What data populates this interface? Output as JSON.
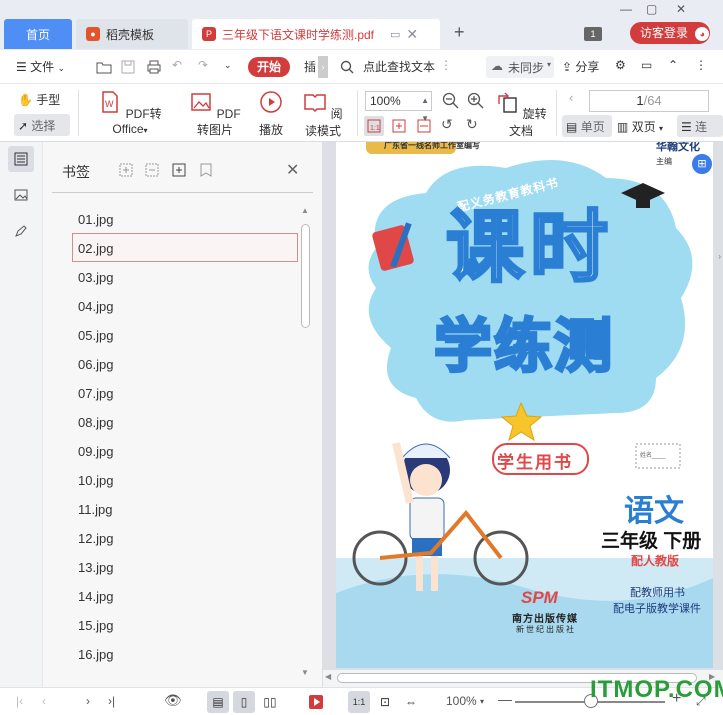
{
  "tabs": {
    "home": "首页",
    "templates": "稻壳模板",
    "document": "三年级下语文课时学练测.pdf"
  },
  "titlebar": {
    "badge": "1",
    "login": "访客登录"
  },
  "menubar": {
    "file": "文件",
    "start": "开始",
    "insert_partial": "插",
    "search": "点此查找文本",
    "sync": "未同步",
    "share": "分享"
  },
  "toolbar": {
    "hand": "手型",
    "select": "选择",
    "pdf_to_office": "PDF转Office",
    "pdf_to_image": "PDF转图片",
    "play": "播放",
    "read_mode": "阅读模式",
    "zoom": "100%",
    "rotate": "旋转文档",
    "single_page": "单页",
    "double_page": "双页",
    "continuous_partial": "连",
    "page_current": "1",
    "page_total": "/64"
  },
  "bookmarks": {
    "title": "书签",
    "items": [
      "01.jpg",
      "02.jpg",
      "03.jpg",
      "04.jpg",
      "05.jpg",
      "06.jpg",
      "07.jpg",
      "08.jpg",
      "09.jpg",
      "10.jpg",
      "11.jpg",
      "12.jpg",
      "13.jpg",
      "14.jpg",
      "15.jpg",
      "16.jpg"
    ],
    "selected_index": 1
  },
  "cover": {
    "series": "配义务教育教科书",
    "top_left_line": "广东省一线名师工作室编写",
    "publisher_brand": "华翰文化",
    "editor_partial": "主编",
    "title_line1": "课时",
    "title_line2": "学练测",
    "student_book": "学生用书",
    "subject": "语文",
    "grade": "三年级 下册",
    "edition": "配人教版",
    "teacher_book": "配教师用书",
    "courseware": "配电子版教学课件",
    "publisher_logo": "SPM",
    "publisher_name": "南方出版传媒",
    "publisher_sub": "新世纪出版社",
    "stamp_text": "姓名____"
  },
  "statusbar": {
    "zoom": "100%"
  },
  "watermark": "ITMOP.COM",
  "colors": {
    "accent_red": "#d23c3c",
    "tab_blue": "#4f8ef5",
    "title_blue": "#2a7fd4",
    "watermark_green": "#2a9d3a"
  }
}
